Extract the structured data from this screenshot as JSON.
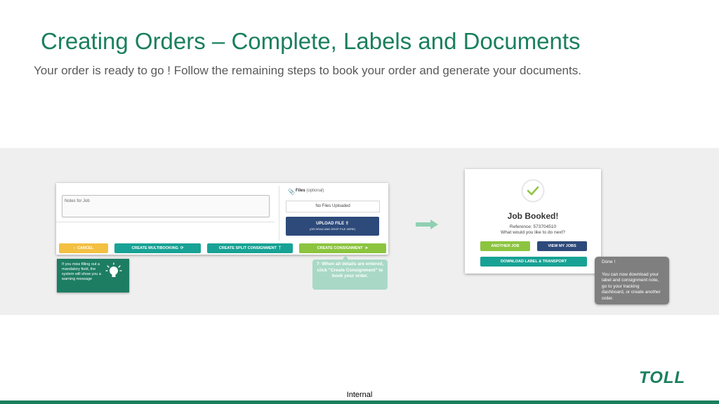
{
  "slide": {
    "title": "Creating Orders – Complete, Labels and Documents",
    "subtitle": "Your order is ready to go ! Follow the remaining steps to book your order and generate your documents.",
    "footer_label": "Internal",
    "accent_color": "#1a7f5e"
  },
  "left_screen": {
    "notes_placeholder": "Notes for Job",
    "files_label": "Files",
    "files_optional": "(optional)",
    "no_files": "No Files Uploaded",
    "upload_label": "UPLOAD FILE",
    "upload_hint": "(OR DRAG AND DROP FILE HERE)",
    "buttons": {
      "cancel": "CANCEL",
      "multibooking": "CREATE MULTIBOOKING",
      "split": "CREATE SPLIT CONSIGNMENT",
      "create": "CREATE CONSIGNMENT"
    },
    "warning_text": "If you miss filling out a mandatory field, the system will show you a warning message",
    "tip_text": "7- When all details are entered, click \"Create Consignment\" to book your order."
  },
  "right_screen": {
    "title": "Job Booked!",
    "reference": "Reference: 573704510",
    "question": "What would you like to do next?",
    "buttons": {
      "another_job": "ANOTHER JOB",
      "view_jobs": "VIEW MY JOBS",
      "download": "DOWNLOAD LABEL & TRANSPORT"
    },
    "done_title": "Done !",
    "done_text": "You can now download your label and consignment note, go to your tracking dashboard, or create another order."
  },
  "logo": {
    "text": "TOLL",
    "color": "#1a7f5e"
  }
}
